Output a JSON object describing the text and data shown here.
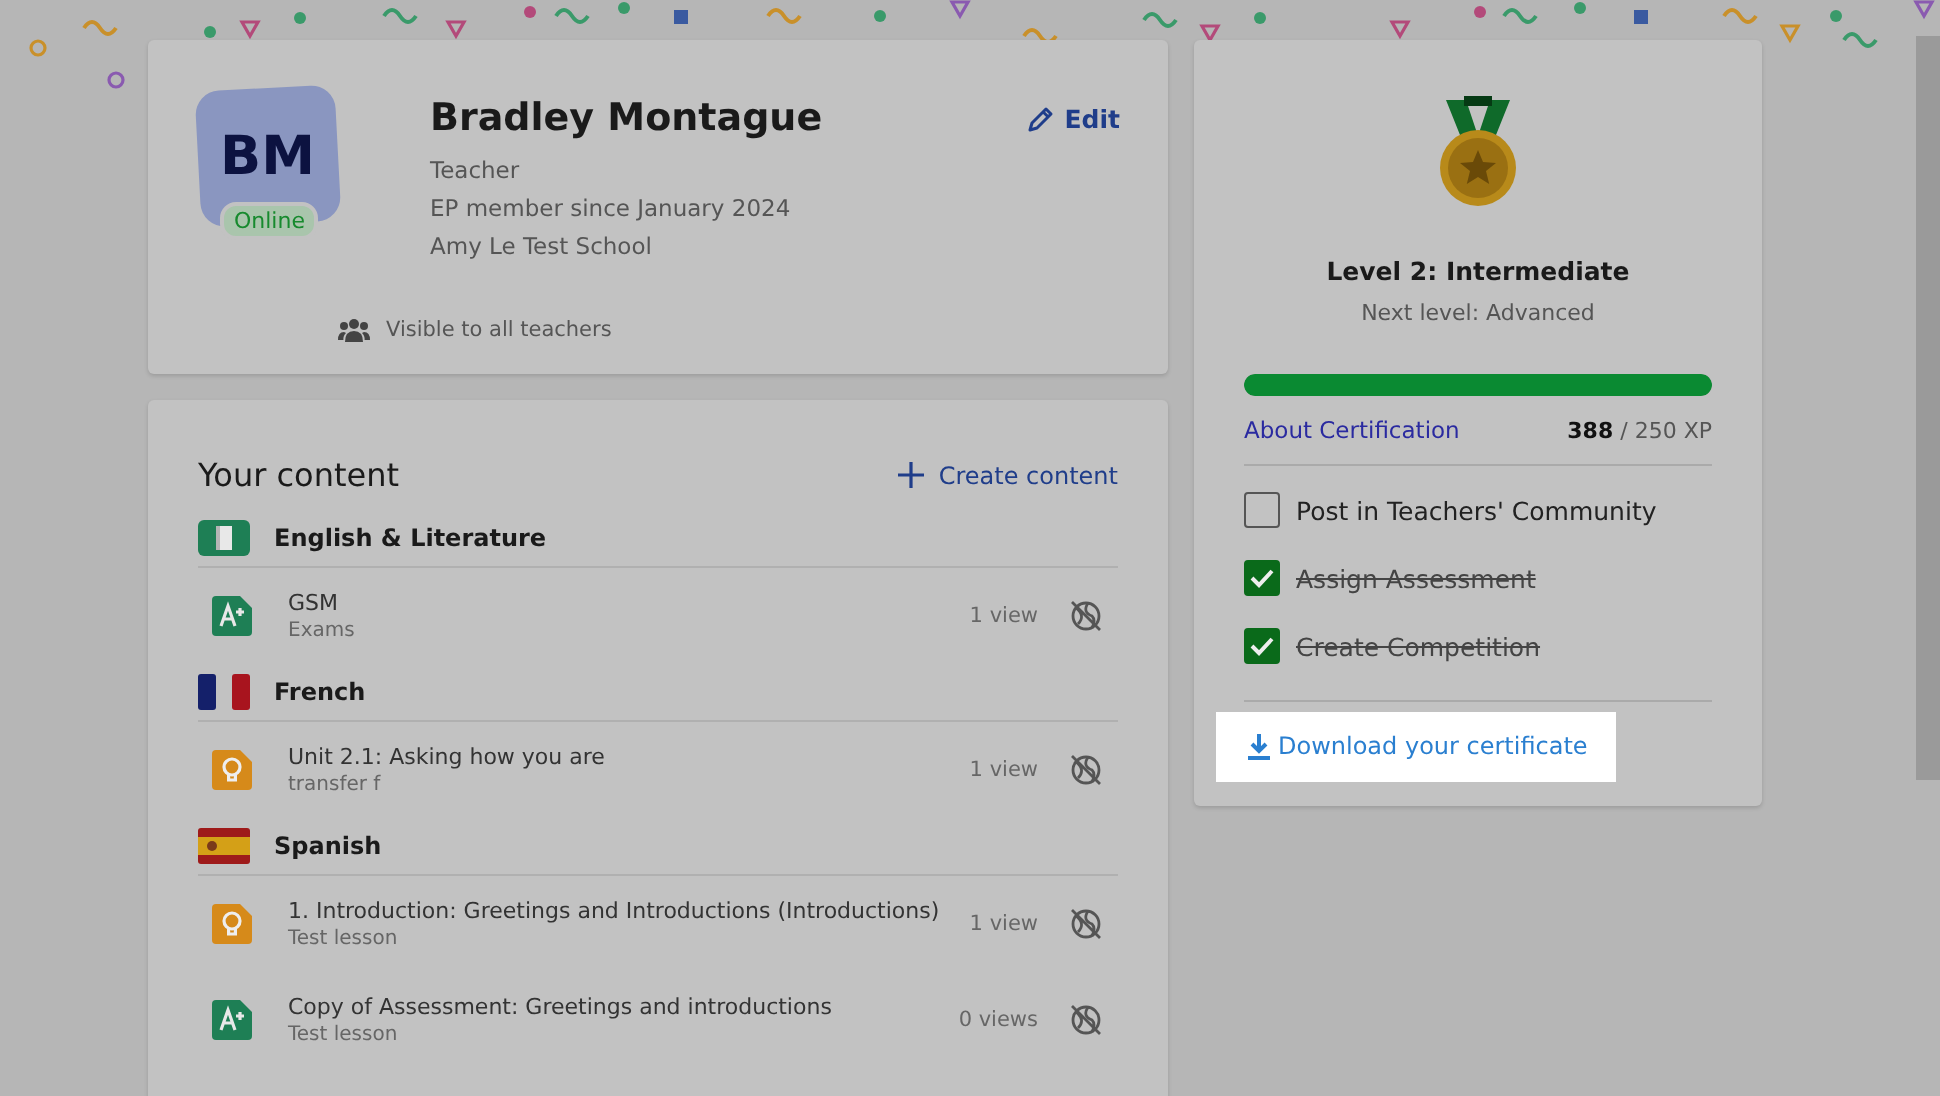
{
  "profile": {
    "initials": "BM",
    "status": "Online",
    "online": true,
    "name": "Bradley Montague",
    "role": "Teacher",
    "member_since": "EP member since January 2024",
    "school": "Amy Le Test School",
    "visibility": "Visible to all teachers",
    "edit_label": "Edit"
  },
  "content": {
    "title": "Your content",
    "create_label": "Create content",
    "groups": [
      {
        "subject": "English & Literature",
        "kind": "book",
        "items": [
          {
            "title": "GSM",
            "subtitle": "Exams",
            "kind": "assessment",
            "views": "1 view"
          }
        ]
      },
      {
        "subject": "French",
        "kind": "flag-fr",
        "items": [
          {
            "title": "Unit 2.1: Asking how you are",
            "subtitle": "transfer f",
            "kind": "lesson",
            "views": "1 view"
          }
        ]
      },
      {
        "subject": "Spanish",
        "kind": "flag-es",
        "items": [
          {
            "title": "1. Introduction: Greetings and Introductions (Introductions)",
            "subtitle": "Test lesson",
            "kind": "lesson",
            "views": "1 view"
          },
          {
            "title": "Copy of Assessment: Greetings and introductions",
            "subtitle": "Test lesson",
            "kind": "assessment",
            "views": "0 views"
          }
        ]
      }
    ]
  },
  "certification": {
    "level_title": "Level 2: Intermediate",
    "next_level": "Next level: Advanced",
    "level": 1,
    "about_link": "About Certification",
    "xp_current": "388",
    "xp_total": "/ 250 XP",
    "tasks": [
      {
        "label": "Post in Teachers' Community",
        "checked": false
      },
      {
        "label": "Assign Assessment",
        "checked": true
      },
      {
        "label": "Create Competition",
        "checked": true
      }
    ],
    "download_label": "Download your certificate"
  }
}
